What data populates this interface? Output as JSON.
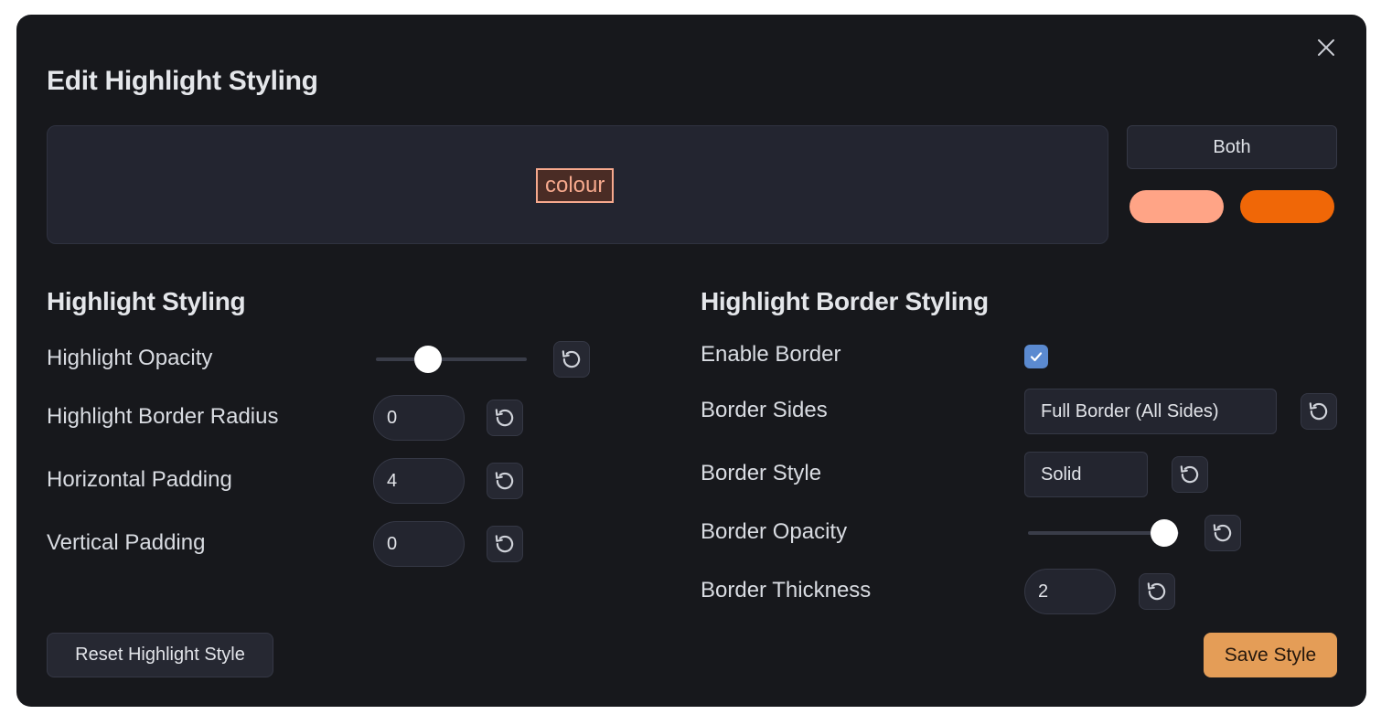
{
  "dialog": {
    "title": "Edit Highlight Styling",
    "close_icon": "close-icon"
  },
  "preview": {
    "sample_text": "colour",
    "mode_button": "Both",
    "swatches": [
      {
        "name": "highlight-color",
        "color": "#ffa486"
      },
      {
        "name": "border-color",
        "color": "#f06707"
      }
    ]
  },
  "highlight_section": {
    "heading": "Highlight Styling",
    "opacity": {
      "label": "Highlight Opacity",
      "value_fraction": 0.34
    },
    "border_radius": {
      "label": "Highlight Border Radius",
      "value": "0"
    },
    "horizontal_padding": {
      "label": "Horizontal Padding",
      "value": "4"
    },
    "vertical_padding": {
      "label": "Vertical Padding",
      "value": "0"
    }
  },
  "border_section": {
    "heading": "Highlight Border Styling",
    "enable": {
      "label": "Enable Border",
      "checked": true
    },
    "sides": {
      "label": "Border Sides",
      "value": "Full Border (All Sides)"
    },
    "style": {
      "label": "Border Style",
      "value": "Solid"
    },
    "opacity": {
      "label": "Border Opacity",
      "value_fraction": 1.0
    },
    "thickness": {
      "label": "Border Thickness",
      "value": "2"
    }
  },
  "footer": {
    "reset_label": "Reset Highlight Style",
    "save_label": "Save Style"
  },
  "colors": {
    "background": "#17181c",
    "accent_save": "#e49d57",
    "checkbox": "#5b8ad0"
  }
}
